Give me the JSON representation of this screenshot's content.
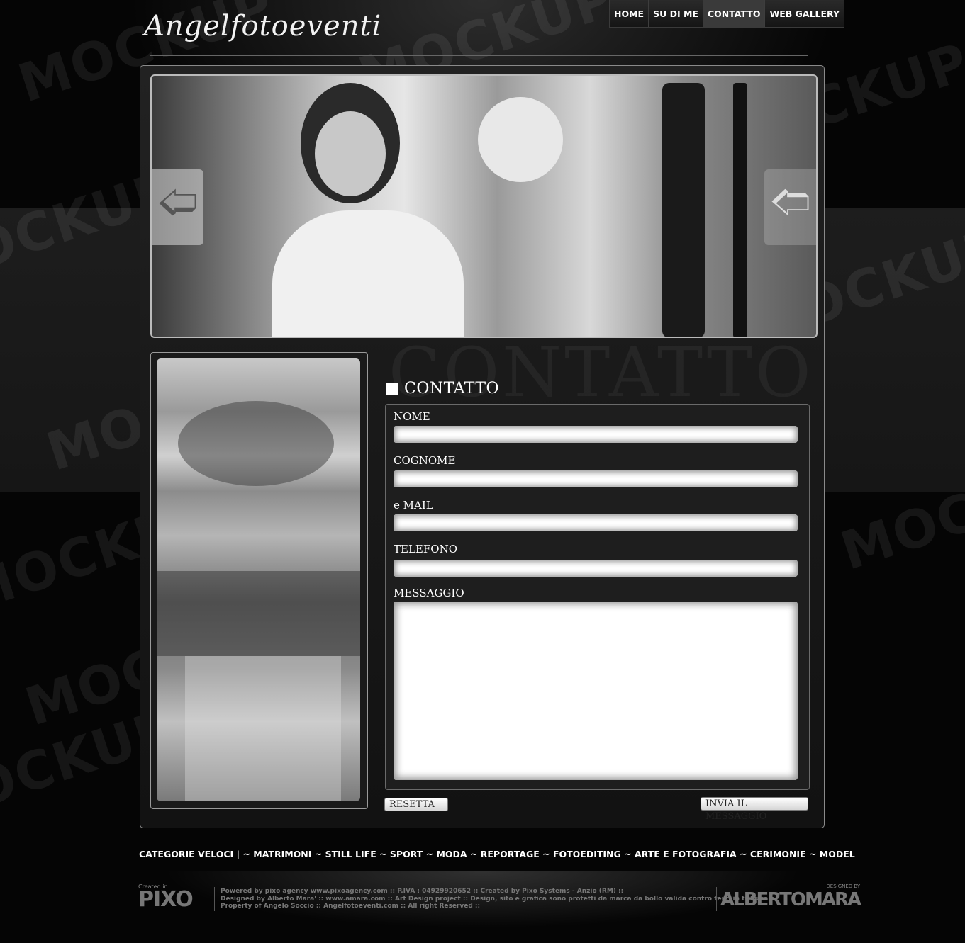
{
  "watermark": "MOCKUP",
  "header": {
    "logo": "Angelfotoeventi",
    "nav": [
      "HOME",
      "SU DI ME",
      "CONTATTO",
      "WEB GALLERY"
    ],
    "active_nav": "CONTATTO"
  },
  "slider": {
    "prev_icon": "arrow-left-icon",
    "next_icon": "arrow-right-icon"
  },
  "contact": {
    "background_word": "CONTATTO",
    "title": "CONTATTO",
    "fields": {
      "nome": "NOME",
      "cognome": "COGNOME",
      "email": "e MAIL",
      "telefono": "TELEFONO",
      "messaggio": "MESSAGGIO"
    },
    "reset_label": "RESETTA",
    "submit_label": "INVIA IL MESSAGGIO"
  },
  "categories": "CATEGORIE VELOCI  |  ~ MATRIMONI ~ STILL LIFE  ~  SPORT ~ MODA ~ REPORTAGE ~ FOTOEDITING ~ ARTE E FOTOGRAFIA ~ CERIMONIE ~ MODEL",
  "footer": {
    "pixo_created": "Created in",
    "pixo_logo": "PIXO",
    "line1": "Powered by pixo agency  www.pixoagency.com :: P.IVA : 04929920652 :: Created by Pixo Systems - Anzio (RM) ::",
    "line2": "Designed by Alberto Mara' :: www.amara.com :: Art Design project :: Design, sito e grafica sono protetti da marca da bollo valida contro terzi in tribunale",
    "line3": "Property of Angelo Soccio :: Angelfotoeventi.com :: All right Reserved ::",
    "designed_by": "DESIGNED BY",
    "designer_logo": "ALBERTOMARA"
  }
}
